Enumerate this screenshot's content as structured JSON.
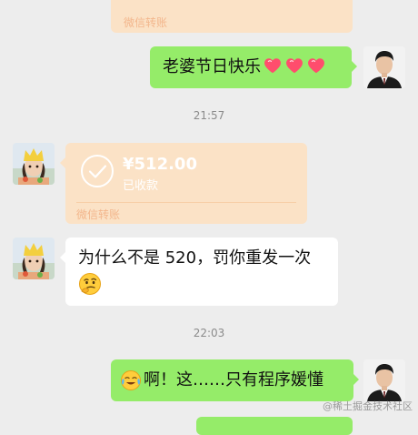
{
  "top_transfer": {
    "label": "微信转账"
  },
  "messages": {
    "m1": {
      "text": "老婆节日快乐"
    },
    "time1": "21:57",
    "transfer": {
      "amount": "¥512.00",
      "status": "已收款",
      "label": "微信转账"
    },
    "m2": {
      "text": "为什么不是 520，罚你重发一次"
    },
    "time2": "22:03",
    "m3": {
      "text": "啊！这……只有程序媛懂"
    }
  },
  "watermark": "@稀土掘金技术社区",
  "colors": {
    "background": "#ededed",
    "sent_bubble": "#95ec69",
    "received_bubble": "#ffffff",
    "transfer_bubble": "#fbe2c6"
  },
  "icons": {
    "heart": "heart-emoji",
    "check": "check-circle-icon",
    "thinking": "thinking-face-emoji",
    "crying": "crying-laughing-emoji"
  }
}
